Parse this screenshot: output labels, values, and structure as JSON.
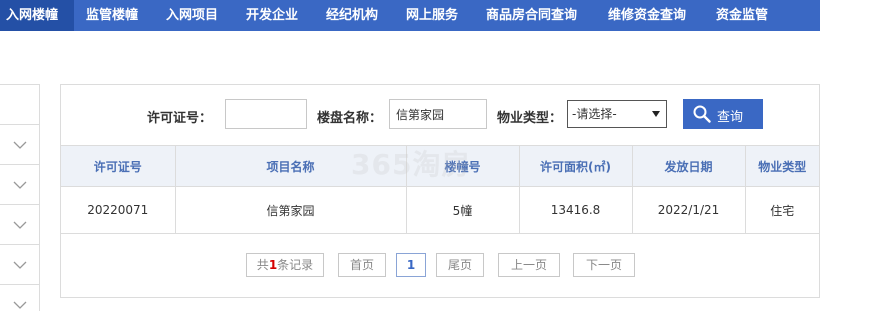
{
  "nav": {
    "items": [
      "入网楼幢",
      "监管楼幢",
      "入网项目",
      "开发企业",
      "经纪机构",
      "网上服务",
      "商品房合同查询",
      "维修资金查询",
      "资金监管"
    ],
    "active_index": 0
  },
  "search": {
    "permit_label": "许可证号：",
    "permit_value": "",
    "project_label": "楼盘名称：",
    "project_value": "信第家园",
    "type_label": "物业类型：",
    "type_selected": "-请选择-",
    "query_label": "查询"
  },
  "table": {
    "headers": [
      "许可证号",
      "项目名称",
      "楼幢号",
      "许可面积(㎡)",
      "发放日期",
      "物业类型"
    ],
    "rows": [
      [
        "20220071",
        "信第家园",
        "5幢",
        "13416.8",
        "2022/1/21",
        "住宅"
      ]
    ]
  },
  "pager": {
    "total_prefix": "共",
    "total_count": "1",
    "total_suffix": "条记录",
    "first": "首页",
    "current": "1",
    "last": "尾页",
    "prev": "上一页",
    "next": "下一页"
  },
  "watermark": "365淘房",
  "colors": {
    "nav_bg": "#3a68c4",
    "nav_active": "#2450a6",
    "header_text": "#4a6fb5"
  }
}
